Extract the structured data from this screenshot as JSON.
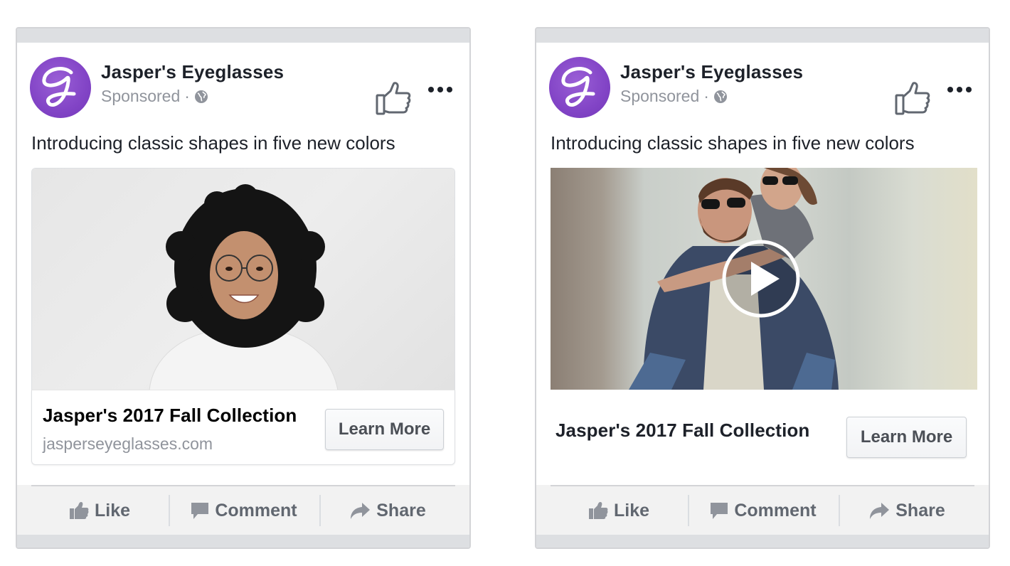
{
  "colors": {
    "brand_purple": "#8244c6",
    "text_primary": "#1d2129",
    "text_secondary": "#90949c",
    "action_text": "#616770",
    "card_border": "#d3d4d7",
    "action_bar_bg": "#f2f2f2"
  },
  "ads": [
    {
      "variant": "image",
      "page_name": "Jasper's Eyeglasses",
      "avatar_letter": "J",
      "sponsored_label": "Sponsored",
      "separator": "·",
      "icons": {
        "audience": "globe-icon",
        "page_like": "thumbs-up-outline-icon",
        "more": "more-options-icon"
      },
      "post_text": "Introducing classic shapes in five new colors",
      "media_description": "Smiling woman with curly hair wearing round eyeglasses",
      "link_title": "Jasper's 2017 Fall Collection",
      "link_domain": "jasperseyeglasses.com",
      "cta_label": "Learn More",
      "actions": [
        {
          "label": "Like",
          "icon": "thumbs-up-icon"
        },
        {
          "label": "Comment",
          "icon": "comment-icon"
        },
        {
          "label": "Share",
          "icon": "share-arrow-icon"
        }
      ]
    },
    {
      "variant": "video",
      "page_name": "Jasper's Eyeglasses",
      "avatar_letter": "J",
      "sponsored_label": "Sponsored",
      "separator": "·",
      "icons": {
        "audience": "globe-icon",
        "page_like": "thumbs-up-outline-icon",
        "more": "more-options-icon",
        "play": "play-icon"
      },
      "post_text": "Introducing classic shapes in five new colors",
      "media_description": "Couple in sunglasses, man giving woman a piggyback ride",
      "link_title": "Jasper's 2017 Fall Collection",
      "cta_label": "Learn More",
      "actions": [
        {
          "label": "Like",
          "icon": "thumbs-up-icon"
        },
        {
          "label": "Comment",
          "icon": "comment-icon"
        },
        {
          "label": "Share",
          "icon": "share-arrow-icon"
        }
      ]
    }
  ]
}
